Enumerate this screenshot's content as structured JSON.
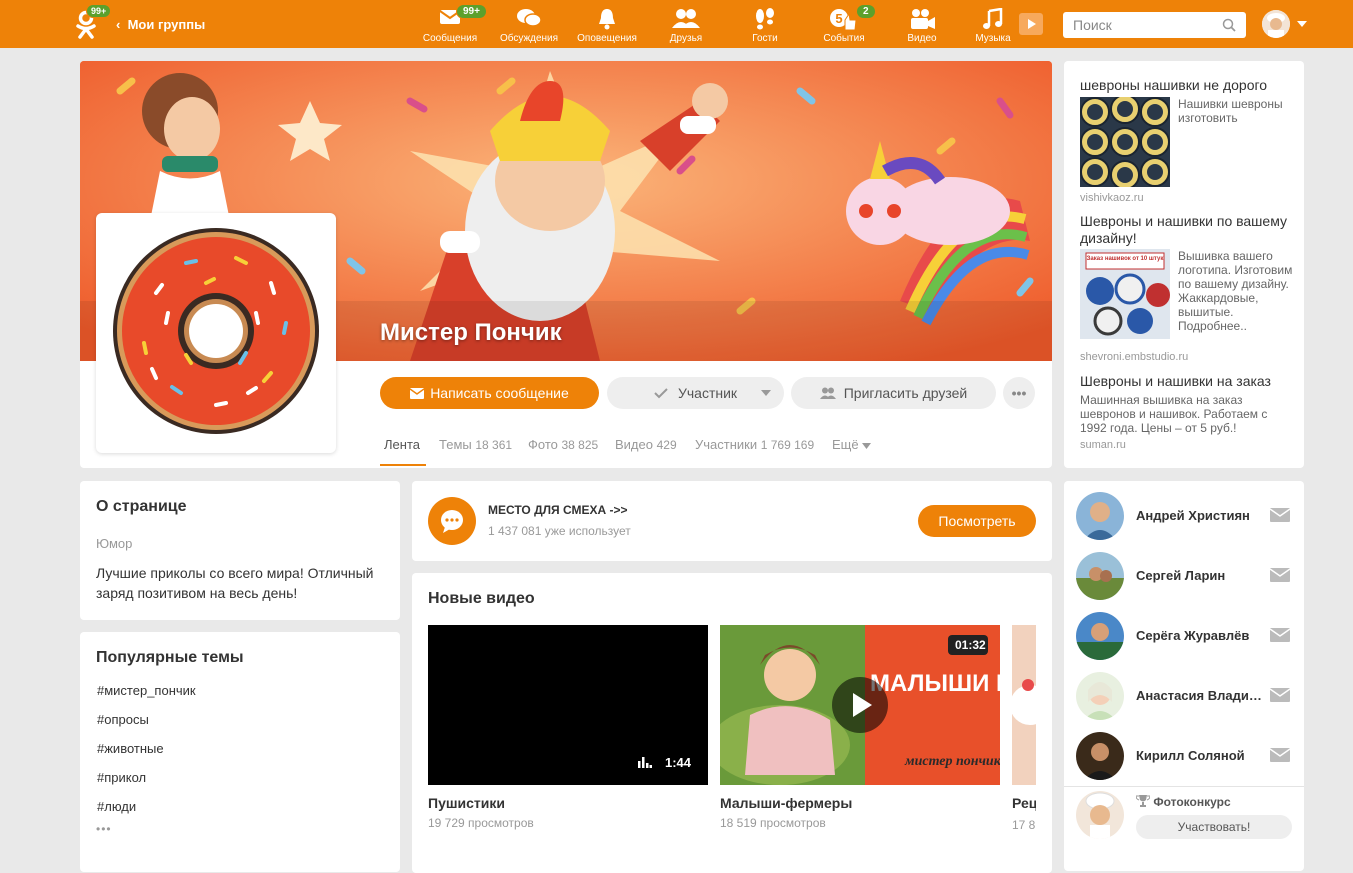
{
  "header": {
    "logo_badge": "99+",
    "back_label": "Мои группы",
    "nav": [
      {
        "label": "Сообщения",
        "icon": "envelope-icon",
        "badge": "99+"
      },
      {
        "label": "Обсуждения",
        "icon": "chat-icon",
        "badge": ""
      },
      {
        "label": "Оповещения",
        "icon": "bell-icon",
        "badge": ""
      },
      {
        "label": "Друзья",
        "icon": "friends-icon",
        "badge": ""
      },
      {
        "label": "Гости",
        "icon": "footprints-icon",
        "badge": ""
      },
      {
        "label": "События",
        "icon": "like-icon",
        "badge": "2"
      },
      {
        "label": "Видео",
        "icon": "camera-icon",
        "badge": ""
      },
      {
        "label": "Музыка",
        "icon": "music-icon",
        "badge": ""
      }
    ],
    "events_count": "5",
    "search_placeholder": "Поиск"
  },
  "group": {
    "name": "Мистер Пончик",
    "write_button": "Написать сообщение",
    "member_button": "Участник",
    "invite_button": "Пригласить друзей",
    "tabs": [
      {
        "label": "Лента",
        "count": ""
      },
      {
        "label": "Темы",
        "count": "18 361"
      },
      {
        "label": "Фото",
        "count": "38 825"
      },
      {
        "label": "Видео",
        "count": "429"
      },
      {
        "label": "Участники",
        "count": "1 769 169"
      },
      {
        "label": "Ещё",
        "count": ""
      }
    ]
  },
  "ads": [
    {
      "title": "шевроны нашивки не дорого",
      "text": "Нашивки шевроны изготовить",
      "source": "vishivkaoz.ru"
    },
    {
      "title": "Шевроны и нашивки по вашему дизайну!",
      "text": "Вышивка вашего логотипа. Изготовим по вашему дизайну. Жаккардовые, вышитые. Подробнее..",
      "source": "shevroni.embstudio.ru",
      "image_text": "Заказ нашивок от 10 штук"
    },
    {
      "title": "Шевроны и нашивки на заказ",
      "text": "Машинная вышивка на заказ шевронов и нашивок. Работаем с 1992 года. Цены – от 5 руб.!",
      "source": "suman.ru"
    }
  ],
  "about": {
    "title": "О странице",
    "category": "Юмор",
    "description": "Лучшие приколы со всего мира! Отличный заряд позитивом на весь день!"
  },
  "popular_topics": {
    "title": "Популярные темы",
    "items": [
      "#мистер_пончик",
      "#опросы",
      "#животные",
      "#прикол",
      "#люди"
    ],
    "more": "•••"
  },
  "app_promo": {
    "title": "МЕСТО ДЛЯ СМЕХА ->>",
    "users": "1 437 081 уже использует",
    "button": "Посмотреть"
  },
  "videos": {
    "title": "Новые видео",
    "items": [
      {
        "title": "Пушистики",
        "views": "19 729 просмотров",
        "duration": "1:44"
      },
      {
        "title": "Малыши-фермеры",
        "views": "18 519 просмотров",
        "duration": "01:32",
        "thumb_text": "МАЛЫШИ НА ФЕРМЕ",
        "thumb_brand": "мистер пончик"
      },
      {
        "title": "Рец",
        "views": "17 8"
      }
    ]
  },
  "friends": [
    {
      "name": "Андрей Християн"
    },
    {
      "name": "Сергей Ларин"
    },
    {
      "name": "Серёга Журавлёв"
    },
    {
      "name": "Анастасия Владис…"
    },
    {
      "name": "Кирилл Соляной"
    }
  ],
  "photo_contest": {
    "label": "Фотоконкурс",
    "button": "Участвовать!"
  },
  "colors": {
    "accent": "#ee8208",
    "badge": "#5ca02c"
  }
}
